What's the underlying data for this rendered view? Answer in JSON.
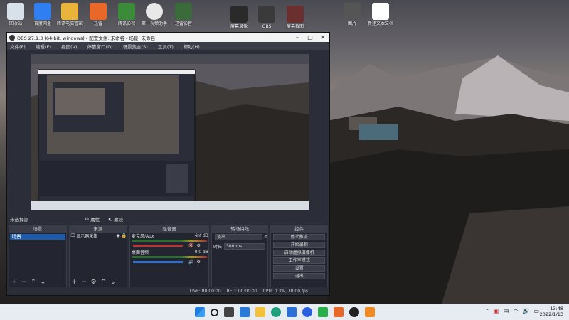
{
  "desktop": {
    "icons": [
      {
        "label": "回收站",
        "color": "#d8e0ea"
      },
      {
        "label": "百度网盘",
        "color": "#2f7ef2"
      },
      {
        "label": "腾讯电脑管家",
        "color": "#e9b43a"
      },
      {
        "label": "迅雷",
        "color": "#e8682a"
      },
      {
        "label": "腾讯影视",
        "color": "#3b8b3b"
      },
      {
        "label": "第一视频助手",
        "color": "#e8e8e8"
      },
      {
        "label": "迅雷影音",
        "color": "#3b6b3b"
      },
      {
        "label": "屏幕录像",
        "color": "#2a2a2a"
      },
      {
        "label": "OBS",
        "color": "#3a3a3a"
      },
      {
        "label": "屏幕截图",
        "color": "#6a3030"
      },
      {
        "label": "图片",
        "color": "#555"
      },
      {
        "label": "新建文本文档",
        "color": "#ffffff"
      }
    ]
  },
  "obs": {
    "title": "OBS 27.1.3 (64-bit, windows) - 配置文件: 未命名 - 场景: 未命名",
    "menu": [
      "文件(F)",
      "编辑(E)",
      "视图(V)",
      "停靠窗口(D)",
      "场景集合(S)",
      "工具(T)",
      "帮助(H)"
    ],
    "source_bar": {
      "label": "未选择源",
      "properties": "属性",
      "filters": "滤镜"
    },
    "docks": {
      "scenes": {
        "title": "场景",
        "items": [
          "场景"
        ]
      },
      "sources": {
        "title": "来源",
        "items": [
          "显示器采集"
        ]
      },
      "mixer": {
        "title": "混音器",
        "channels": [
          {
            "name": "麦克风/Aux",
            "db": "-inf dB",
            "muted": true
          },
          {
            "name": "桌面音频",
            "db": "0.0 dB",
            "muted": false
          }
        ]
      },
      "transitions": {
        "title": "转场特效",
        "type": "淡出",
        "duration_label": "时长",
        "duration": "300 ms"
      },
      "controls": {
        "title": "控件",
        "buttons": [
          "停止推流",
          "开始录制",
          "启动虚拟摄像机",
          "工作室模式",
          "设置",
          "退出"
        ]
      }
    },
    "status": {
      "live": "LIVE: 00:00:00",
      "rec": "REC: 00:00:00",
      "cpu": "CPU: 0.3%, 30.00 fps"
    }
  },
  "taskbar": {
    "time": "13:48",
    "date": "2022/1/13",
    "lang": "中",
    "accent": "#e7ecf3"
  }
}
